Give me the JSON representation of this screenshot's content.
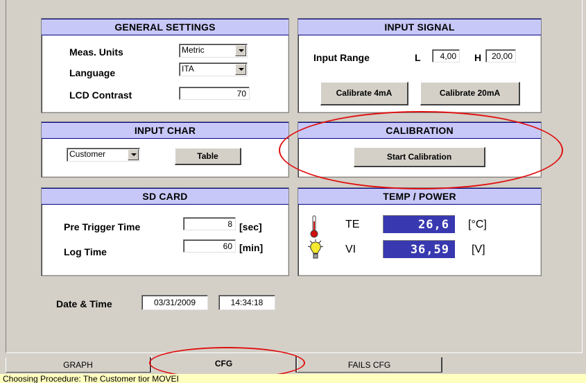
{
  "general_settings": {
    "title": "GENERAL SETTINGS",
    "meas_units_label": "Meas. Units",
    "meas_units_value": "Metric",
    "language_label": "Language",
    "language_value": "ITA",
    "lcd_contrast_label": "LCD Contrast",
    "lcd_contrast_value": "70"
  },
  "input_signal": {
    "title": "INPUT SIGNAL",
    "input_range_label": "Input Range",
    "low_label": "L",
    "low_value": "4,00",
    "high_label": "H",
    "high_value": "20,00",
    "calibrate_4ma": "Calibrate 4mA",
    "calibrate_20ma": "Calibrate 20mA"
  },
  "input_char": {
    "title": "INPUT CHAR",
    "select_value": "Customer",
    "table_button": "Table"
  },
  "calibration": {
    "title": "CALIBRATION",
    "start_button": "Start Calibration"
  },
  "sd_card": {
    "title": "SD CARD",
    "pre_trigger_label": "Pre Trigger Time",
    "pre_trigger_value": "8",
    "pre_trigger_unit": "[sec]",
    "log_time_label": "Log Time",
    "log_time_value": "60",
    "log_time_unit": "[min]"
  },
  "temp_power": {
    "title": "TEMP / POWER",
    "te_label": "TE",
    "te_value": "26,6",
    "te_unit": "[°C]",
    "vi_label": "VI",
    "vi_value": "36,59",
    "vi_unit": "[V]"
  },
  "date_time": {
    "label": "Date & Time",
    "date": "03/31/2009",
    "time": "14:34:18"
  },
  "tabs": [
    {
      "label": "GRAPH"
    },
    {
      "label": "CFG"
    },
    {
      "label": "FAILS CFG"
    }
  ],
  "status_text": "Choosing Procedure: The Customer tior MOVEI",
  "colors": {
    "header_bg": "#c8c8f8",
    "lcd_bg": "#3838b0",
    "annotation": "#e01010",
    "status_bg": "#ffffc0"
  }
}
